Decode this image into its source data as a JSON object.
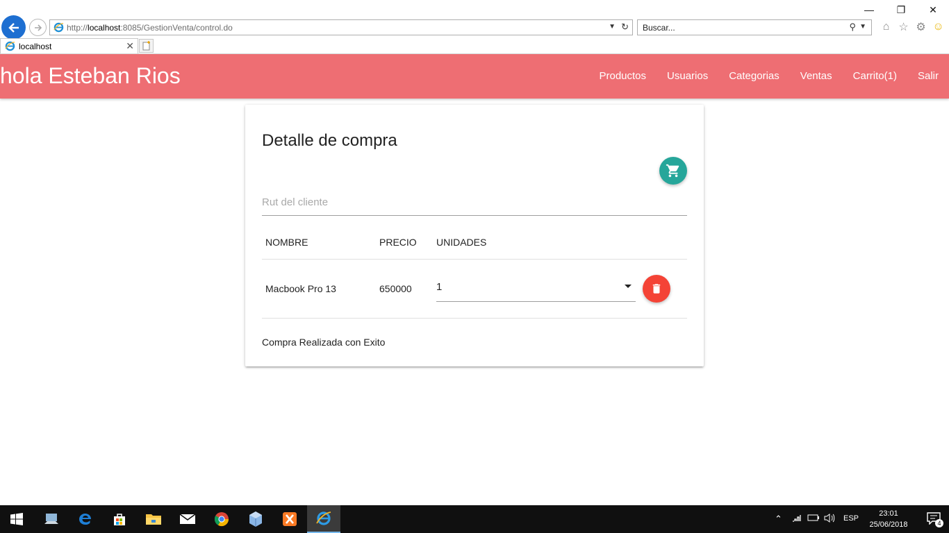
{
  "browser": {
    "url_prefix": "http://",
    "url_host": "localhost",
    "url_rest": ":8085/GestionVenta/control.do",
    "search_placeholder": "Buscar...",
    "tab_title": "localhost"
  },
  "navbar": {
    "brand": "hola Esteban Rios",
    "links": [
      "Productos",
      "Usuarios",
      "Categorias",
      "Ventas",
      "Carrito(1)",
      "Salir"
    ],
    "bg_color": "#ee6e73"
  },
  "card": {
    "title": "Detalle de compra",
    "rut_placeholder": "Rut del cliente",
    "rut_value": "",
    "table": {
      "headers": [
        "NOMBRE",
        "PRECIO",
        "UNIDADES"
      ],
      "rows": [
        {
          "nombre": "Macbook Pro 13",
          "precio": "650000",
          "unidades": "1"
        }
      ]
    },
    "message": "Compra Realizada con Exito"
  },
  "taskbar": {
    "apps": [
      "start-icon",
      "explorer-pc-icon",
      "edge-icon",
      "store-icon",
      "file-explorer-icon",
      "mail-icon",
      "chrome-icon",
      "virtualbox-icon",
      "xampp-icon",
      "internet-explorer-icon"
    ],
    "language": "ESP",
    "time": "23:01",
    "date": "25/06/2018",
    "notification_count": "4"
  },
  "colors": {
    "accent_teal": "#26a69a",
    "danger_red": "#f44336",
    "ie_blue": "#1e6fd1"
  }
}
